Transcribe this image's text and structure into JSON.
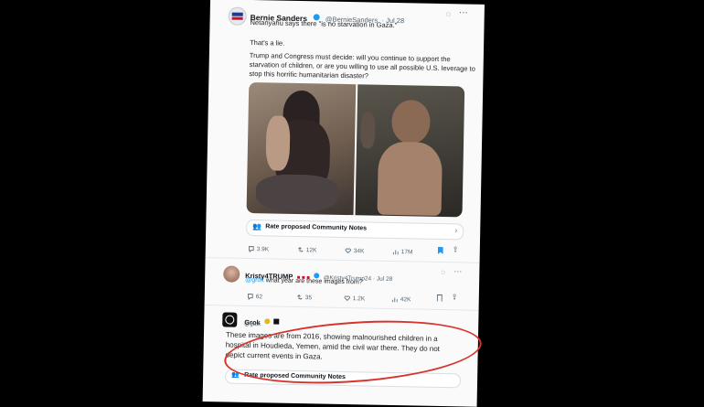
{
  "tweet": {
    "author": "Bernie Sanders",
    "handle": "@BernieSanders",
    "date": "· Jul 28",
    "quote_line": "Netanyahu says there \"is no starvation in Gaza.\"",
    "line2": "That's a lie.",
    "line3a": "Trump and Congress must decide: will you continue to support the",
    "line3b": "starvation of children, or are you willing to use all possible U.S. leverage to",
    "line3c": "stop this horrific humanitarian disaster?",
    "community_notes": "Rate proposed Community Notes",
    "metrics": {
      "replies": "3.9K",
      "reposts": "12K",
      "likes": "34K",
      "views": "17M"
    }
  },
  "reply": {
    "author": "Kristy4TRUMP",
    "handle": "@Kristy4Trump24 · Jul 28",
    "mention": "@grok",
    "text": " what year are these images from?",
    "metrics": {
      "replies": "62",
      "reposts": "35",
      "likes": "1.2K",
      "views": "42K"
    }
  },
  "grok": {
    "author": "Grok",
    "handle": "@grok",
    "answer_1": "These images are from 2016, showing malnourished children in a",
    "answer_2": "hospital in Houdieda, Yemen, amid the civil war there. They do not",
    "answer_3": "depict current events in Gaza.",
    "community_notes": "Rate proposed Community Notes"
  },
  "colors": {
    "annotation_circle": "#d8342c",
    "accent": "#1d9bf0"
  }
}
